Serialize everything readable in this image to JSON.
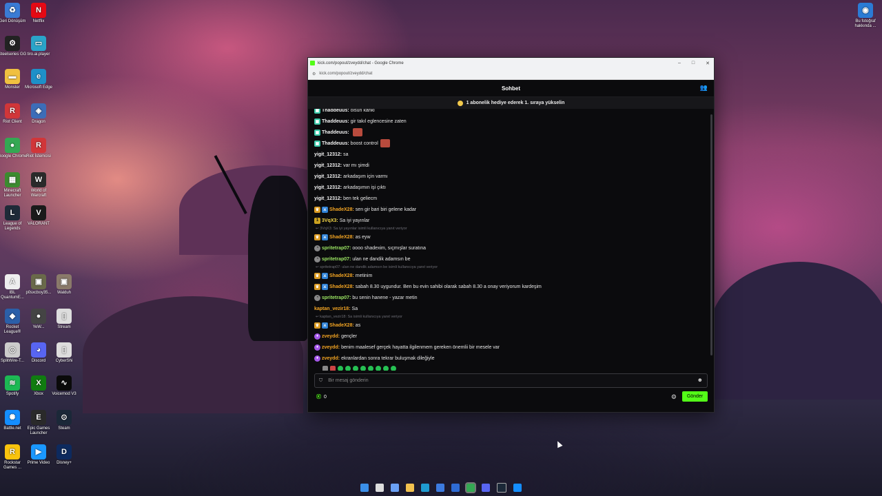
{
  "desktop": {
    "icons_left": [
      {
        "label": "Geri Dönüşüm",
        "icon": "recycle-bin-icon",
        "color": "#3a7bd5",
        "glyph": "♻"
      },
      {
        "label": "Netflix",
        "icon": "netflix-icon",
        "color": "#e50914",
        "glyph": "N"
      },
      {
        "label": "Steelseries GG",
        "icon": "steelseries-icon",
        "color": "#222222",
        "glyph": "⚙"
      },
      {
        "label": "tiro.ai.player",
        "icon": "app-icon",
        "color": "#2aa4c9",
        "glyph": "▭"
      },
      {
        "label": "Monster",
        "icon": "folder-icon",
        "color": "#f0c040",
        "glyph": "▬"
      },
      {
        "label": "Microsoft Edge",
        "icon": "edge-icon",
        "color": "#1e90c8",
        "glyph": "e"
      },
      {
        "label": "Riot Client",
        "icon": "riot-icon",
        "color": "#d13639",
        "glyph": "R"
      },
      {
        "label": "Dragon",
        "icon": "app-icon",
        "color": "#3d6db8",
        "glyph": "◈"
      },
      {
        "label": "Google Chrome",
        "icon": "chrome-icon",
        "color": "#34a853",
        "glyph": "●"
      },
      {
        "label": "Riot İstemcisi",
        "icon": "riot-icon",
        "color": "#d13639",
        "glyph": "R"
      },
      {
        "label": "Minecraft Launcher",
        "icon": "minecraft-icon",
        "color": "#3c8b2f",
        "glyph": "▦"
      },
      {
        "label": "World of Warcraft",
        "icon": "wow-icon",
        "color": "#2a2a2a",
        "glyph": "W"
      },
      {
        "label": "League of Legends",
        "icon": "lol-icon",
        "color": "#1e2a38",
        "glyph": "L"
      },
      {
        "label": "VALORANT",
        "icon": "valorant-icon",
        "color": "#1a1a1a",
        "glyph": "V"
      },
      {
        "label": "IBL QuantumE...",
        "icon": "app-icon",
        "color": "#eeeeee",
        "glyph": "A"
      },
      {
        "label": "p0sxcboy35...",
        "icon": "image-icon",
        "color": "#6a6a4a",
        "glyph": "▣"
      },
      {
        "label": "Walduh",
        "icon": "image-icon",
        "color": "#8a7a6a",
        "glyph": "▣"
      },
      {
        "label": "Rocket League®",
        "icon": "rocket-league-icon",
        "color": "#2b5fa8",
        "glyph": "◆"
      },
      {
        "label": "YeW...",
        "icon": "app-icon",
        "color": "#444444",
        "glyph": "●"
      },
      {
        "label": "Stream",
        "icon": "file-icon",
        "color": "#dddddd",
        "glyph": "▯"
      },
      {
        "label": "SplitWire-T...",
        "icon": "app-icon",
        "color": "#cccccc",
        "glyph": "◎"
      },
      {
        "label": "Discord",
        "icon": "discord-icon",
        "color": "#5865f2",
        "glyph": "◕"
      },
      {
        "label": "CyberShi",
        "icon": "file-icon",
        "color": "#dddddd",
        "glyph": "▯"
      },
      {
        "label": "Spotify",
        "icon": "spotify-icon",
        "color": "#1db954",
        "glyph": "≋"
      },
      {
        "label": "Xbox",
        "icon": "xbox-icon",
        "color": "#107c10",
        "glyph": "X"
      },
      {
        "label": "Voicemod V3",
        "icon": "voicemod-icon",
        "color": "#0a0a0a",
        "glyph": "∿"
      },
      {
        "label": "Battle.net",
        "icon": "battlenet-icon",
        "color": "#148eff",
        "glyph": "✺"
      },
      {
        "label": "Epic Games Launcher",
        "icon": "epic-icon",
        "color": "#2a2a2a",
        "glyph": "E"
      },
      {
        "label": "Steam",
        "icon": "steam-icon",
        "color": "#1b2838",
        "glyph": "⊙"
      },
      {
        "label": "Rockstar Games ...",
        "icon": "rockstar-icon",
        "color": "#f9c30d",
        "glyph": "R"
      },
      {
        "label": "Prime Video",
        "icon": "prime-icon",
        "color": "#1a98ff",
        "glyph": "▶"
      },
      {
        "label": "Disney+",
        "icon": "disney-icon",
        "color": "#0d2a5e",
        "glyph": "D"
      }
    ],
    "icon_right": {
      "label": "Bu fotoğraf hakkında ...",
      "icon": "info-icon"
    }
  },
  "browser": {
    "title": "kick.com/popout/zveydd/chat - Google Chrome",
    "url": "kick.com/popout/zveydd/chat",
    "minimize": "–",
    "maximize": "□",
    "close": "✕"
  },
  "chat": {
    "header_title": "Sohbet",
    "promo_text": "1 abonelik hediye ederek 1. sıraya yükselin",
    "messages": [
      {
        "type": "msg",
        "badges": [
          "teal"
        ],
        "user": "Thaddeuus",
        "color": "white",
        "text": "olsun kanki"
      },
      {
        "type": "msg",
        "badges": [
          "teal"
        ],
        "user": "Thaddeuus",
        "color": "white",
        "text": "gir takıl eglencesine zaten"
      },
      {
        "type": "msg",
        "badges": [
          "teal"
        ],
        "user": "Thaddeuus",
        "color": "white",
        "text": "",
        "emote": true
      },
      {
        "type": "msg",
        "badges": [
          "teal"
        ],
        "user": "Thaddeuus",
        "color": "white",
        "text": "boost control",
        "emote": true
      },
      {
        "type": "msg",
        "badges": [],
        "user": "yigit_12312",
        "color": "white",
        "text": "sa"
      },
      {
        "type": "msg",
        "badges": [],
        "user": "yigit_12312",
        "color": "white",
        "text": "var mı şimdi"
      },
      {
        "type": "msg",
        "badges": [],
        "user": "yigit_12312",
        "color": "white",
        "text": "arkadaşım için varmı"
      },
      {
        "type": "msg",
        "badges": [],
        "user": "yigit_12312",
        "color": "white",
        "text": "arkadaşımın işi çıktı"
      },
      {
        "type": "msg",
        "badges": [],
        "user": "yigit_12312",
        "color": "white",
        "text": "ben tek geliecm"
      },
      {
        "type": "msg",
        "badges": [
          "crown",
          "blue"
        ],
        "user": "ShadeX28",
        "color": "orange",
        "text": "sen gir bari biri gelene kadar"
      },
      {
        "type": "msg",
        "badges": [
          "gold"
        ],
        "user": "3VqX3",
        "color": "yellow",
        "text": "Sa iyi yayınlar"
      },
      {
        "type": "reply",
        "text": "3VqX3: Sa iyi yayınlar isimli kullanıcıya yanıt veriyor"
      },
      {
        "type": "msg",
        "badges": [
          "crown",
          "blue"
        ],
        "user": "ShadeX28",
        "color": "orange",
        "text": "as eyw"
      },
      {
        "type": "msg",
        "badges": [
          "gray"
        ],
        "user": "spritetrap07",
        "color": "green",
        "text": "oooo shadexim, sıçmışlar suratına"
      },
      {
        "type": "msg",
        "badges": [
          "gray"
        ],
        "user": "spritetrap07",
        "color": "green",
        "text": "ulan ne dandik adamsın be"
      },
      {
        "type": "reply",
        "text": "spritetrap07: ulan ne dandik adamsın be isimli kullanıcıya yanıt veriyor"
      },
      {
        "type": "msg",
        "badges": [
          "crown",
          "blue"
        ],
        "user": "ShadeX28",
        "color": "orange",
        "text": "metinim"
      },
      {
        "type": "msg",
        "badges": [
          "crown",
          "blue"
        ],
        "user": "ShadeX28",
        "color": "orange",
        "text": "sabah 8.30 uygundur. Ben bu evin sahibi olarak sabah 8.30 a onay veriyorum kardeşim"
      },
      {
        "type": "msg",
        "badges": [
          "gray"
        ],
        "user": "spritetrap07",
        "color": "green",
        "text": "bu senin hanene - yazar metin"
      },
      {
        "type": "msg",
        "badges": [],
        "user": "kaptan_vezir18",
        "color": "orange",
        "text": "Sa"
      },
      {
        "type": "reply",
        "text": "kaptan_vezir18: Sa isimli kullanıcıya yanıt veriyor"
      },
      {
        "type": "msg",
        "badges": [
          "crown",
          "blue"
        ],
        "user": "ShadeX28",
        "color": "orange",
        "text": "as"
      },
      {
        "type": "msg",
        "badges": [
          "purple"
        ],
        "user": "zveydd",
        "color": "orange",
        "text": "gençler"
      },
      {
        "type": "msg",
        "badges": [
          "purple"
        ],
        "user": "zveydd",
        "color": "orange",
        "text": "benim maalesef gerçek hayatta ilgilenmem gereken önemlii bir mesele var"
      },
      {
        "type": "msg",
        "badges": [
          "purple"
        ],
        "user": "zveydd",
        "color": "orange",
        "text": "ekranlardan sonra tekrar buluşmak dileğiyle"
      }
    ],
    "input_placeholder": "Bir mesaj gönderin",
    "points": "0",
    "send_label": "Gönder"
  },
  "colors": {
    "kick_green": "#53fc18",
    "chat_bg": "#0b0b0d"
  }
}
